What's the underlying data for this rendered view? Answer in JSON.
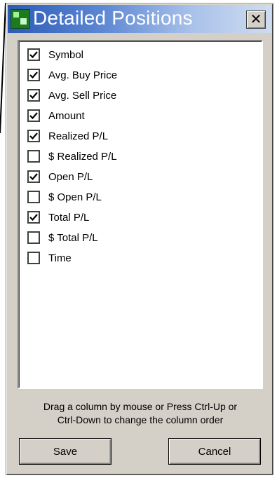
{
  "window": {
    "title": "Detailed Positions",
    "close_symbol": "✕"
  },
  "columns": [
    {
      "label": "Symbol",
      "checked": true
    },
    {
      "label": "Avg. Buy Price",
      "checked": true
    },
    {
      "label": "Avg. Sell Price",
      "checked": true
    },
    {
      "label": "Amount",
      "checked": true
    },
    {
      "label": "Realized P/L",
      "checked": true
    },
    {
      "label": "$ Realized P/L",
      "checked": false
    },
    {
      "label": "Open P/L",
      "checked": true
    },
    {
      "label": "$ Open P/L",
      "checked": false
    },
    {
      "label": "Total P/L",
      "checked": true
    },
    {
      "label": "$ Total P/L",
      "checked": false
    },
    {
      "label": "Time",
      "checked": false
    }
  ],
  "hint": {
    "line1": "Drag a column by mouse or Press Ctrl-Up or",
    "line2": "Ctrl-Down to change the column order"
  },
  "buttons": {
    "save_label": "Save",
    "cancel_label": "Cancel"
  },
  "colors": {
    "title_gradient_start": "#2a5bb8",
    "title_gradient_end": "#cfdcef",
    "app_icon": "#1e7a1e"
  },
  "icons": {
    "app": "app-icon",
    "close": "close-icon",
    "check": "check-icon"
  }
}
